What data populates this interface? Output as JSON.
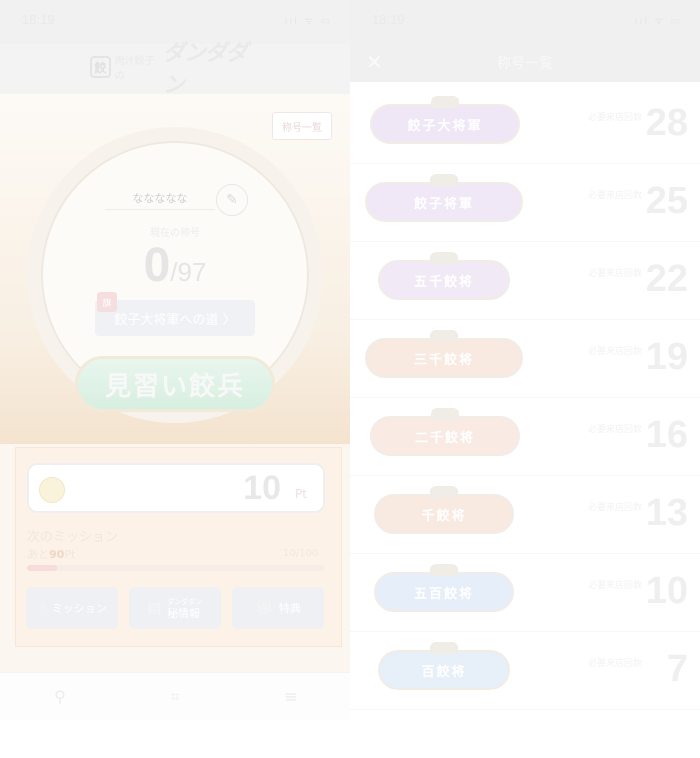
{
  "left_status": {
    "time": "18:19",
    "signals": "ııl ᯤ ▭"
  },
  "header": {
    "logo_badge": "餃",
    "logo_small": "肉汁餃子の",
    "logo_big": "ダンダダン"
  },
  "profile": {
    "title_list_button": "称号一覧",
    "username": "ななななな",
    "current_title_label": "現在の称号",
    "progress_current": "0",
    "progress_total": "/97",
    "road_button": "餃子大将軍への道 〉",
    "road_flag": "旗",
    "rank_name": "見習い餃兵"
  },
  "points": {
    "value": "10",
    "unit": "Pt"
  },
  "mission": {
    "title": "次のミッション",
    "remaining_prefix": "あと",
    "remaining_value": "90",
    "remaining_unit": "Pt",
    "count": "10/100",
    "progress": 0.1
  },
  "actions": {
    "mission_label": "ミッション",
    "info_label_top": "ダンダダン",
    "info_label": "秘情報",
    "perk_label": "特典"
  },
  "tabs": [
    "person-icon",
    "qr-icon",
    "menu-icon"
  ],
  "right_status": {
    "time": "18:19",
    "signals": "ııl ᯤ ▭"
  },
  "titles_nav": {
    "close": "✕",
    "title": "称号一覧"
  },
  "ranks": [
    {
      "name": "餃子大将軍",
      "condition": "必要来店回数",
      "required": "28",
      "color": "#efe6f6"
    },
    {
      "name": "餃子将軍",
      "condition": "必要来店回数",
      "required": "25",
      "color": "#f0e8f7"
    },
    {
      "name": "五千餃将",
      "condition": "必要来店回数",
      "required": "22",
      "color": "#f1eaf6"
    },
    {
      "name": "三千餃将",
      "condition": "必要来店回数",
      "required": "19",
      "color": "#f8e9e1"
    },
    {
      "name": "二千餃将",
      "condition": "必要来店回数",
      "required": "16",
      "color": "#f9ebe3"
    },
    {
      "name": "千餃将",
      "condition": "必要来店回数",
      "required": "13",
      "color": "#f8e9e1"
    },
    {
      "name": "五百餃将",
      "condition": "必要来店回数",
      "required": "10",
      "color": "#e6eefa"
    },
    {
      "name": "百餃将",
      "condition": "必要来店回数",
      "required": "7",
      "color": "#e7eff9"
    }
  ]
}
